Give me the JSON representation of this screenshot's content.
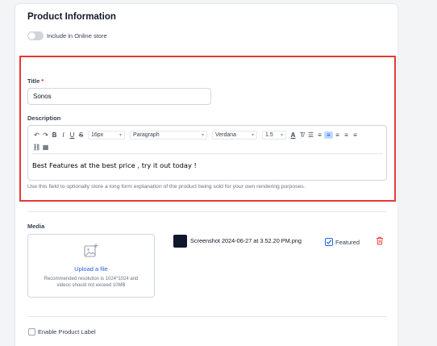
{
  "section": {
    "title": "Product Information"
  },
  "online_store": {
    "label": "Include in Online store",
    "enabled": false
  },
  "title_field": {
    "label": "Title",
    "required_mark": "*",
    "value": "Sonos"
  },
  "description": {
    "label": "Description",
    "toolbar": {
      "undo": "↶",
      "redo": "↷",
      "bold": "B",
      "italic": "I",
      "underline": "U",
      "strike": "S",
      "font_size": "16px",
      "block_format": "Paragraph",
      "font_family": "Verdana",
      "line_height": "1.5",
      "text_color": "A",
      "clear_format": "T̸",
      "bullet": "☰",
      "numbered": "≡",
      "align_left": "≡",
      "align_center": "≡",
      "align_right": "≡",
      "align_justify": "≡",
      "link": "⛓",
      "table": "▦"
    },
    "content": "Best Features at the best price , try it out today !",
    "helper": "Use this field to optionally store a long form explanation of the product being sold for your own rendering purposes."
  },
  "media": {
    "label": "Media",
    "upload_link": "Upload a file",
    "upload_hint_line1": "Recommended resolution is 1024*1024 and",
    "upload_hint_line2": "videos should not exceed 10MB",
    "file": {
      "name": "Screenshot 2024-06-27 at 3.52.20 PM.png",
      "featured_label": "Featured",
      "featured": true
    }
  },
  "product_label": {
    "label": "Enable Product Label",
    "checked": false
  },
  "colors": {
    "accent": "#2563eb",
    "highlight": "#e53935",
    "danger": "#ef4444"
  }
}
